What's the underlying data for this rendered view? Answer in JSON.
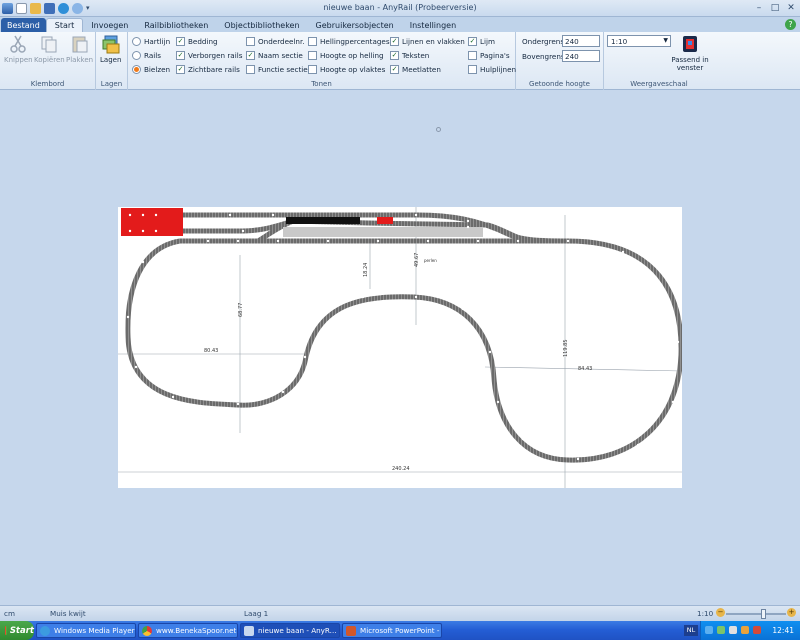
{
  "window": {
    "title": "nieuwe baan - AnyRail (Probeerversie)"
  },
  "tabs": [
    {
      "label": "Bestand"
    },
    {
      "label": "Start"
    },
    {
      "label": "Invoegen"
    },
    {
      "label": "Railbibliotheken"
    },
    {
      "label": "Objectbibliotheken"
    },
    {
      "label": "Gebruikersobjecten"
    },
    {
      "label": "Instellingen"
    }
  ],
  "ribbon": {
    "klembord": {
      "label": "Klembord",
      "knippen": "Knippen",
      "kopieren": "Kopiëren",
      "plakken": "Plakken"
    },
    "lagen": {
      "label": "Lagen",
      "button": "Lagen"
    },
    "tonen": {
      "label": "Tonen",
      "hartlijn": "Hartlijn",
      "rails": "Rails",
      "bielzen": "Bielzen",
      "bedding": "Bedding",
      "verborgen_rails": "Verborgen rails",
      "zichtbare_rails": "Zichtbare rails",
      "onderdeelnr": "Onderdeelnr.",
      "naam_sectie": "Naam sectie",
      "functie_sectie": "Functie sectie",
      "hellingpercentages": "Hellingpercentages",
      "hoogte_op_helling": "Hoogte op helling",
      "hoogte_op_vlaktes": "Hoogte op vlaktes",
      "lijnen_en_vlakken": "Lijnen en vlakken",
      "teksten": "Teksten",
      "meetlatten": "Meetlatten",
      "lijm": "Lijm",
      "paginas": "Pagina's",
      "hulplijnen": "Hulplijnen",
      "check": "✓"
    },
    "hoogte": {
      "label": "Getoonde hoogte",
      "ondergrens_label": "Ondergrens",
      "ondergrens": "240",
      "bovengrens_label": "Bovengrens",
      "bovengrens": "240"
    },
    "weergave": {
      "label": "Weergaveschaal",
      "scale": "1:10",
      "fit": "Passend in venster"
    }
  },
  "drawing": {
    "dimensions": [
      "18.24",
      "49.67",
      "68.77",
      "80.43",
      "119.85",
      "84.43",
      "240.24"
    ],
    "notes": [
      "perlen"
    ],
    "colors": {
      "track": "#6b6b6b",
      "sleeper_dot": "#ffffff",
      "bumper": "#e31b1b",
      "train": "#111111",
      "measure": "#9aa3ad"
    }
  },
  "status": {
    "unit": "cm",
    "glue": "Muis kwijt",
    "layer": "Laag 1",
    "zoom": "1:10"
  },
  "taskbar": {
    "start": "Start",
    "tasks": [
      "Windows Media Player",
      "www.BenekaSpoor.net fo...",
      "nieuwe baan - AnyR...",
      "Microsoft PowerPoint - [Pr..."
    ],
    "lang": "NL",
    "clock": "12:41"
  }
}
